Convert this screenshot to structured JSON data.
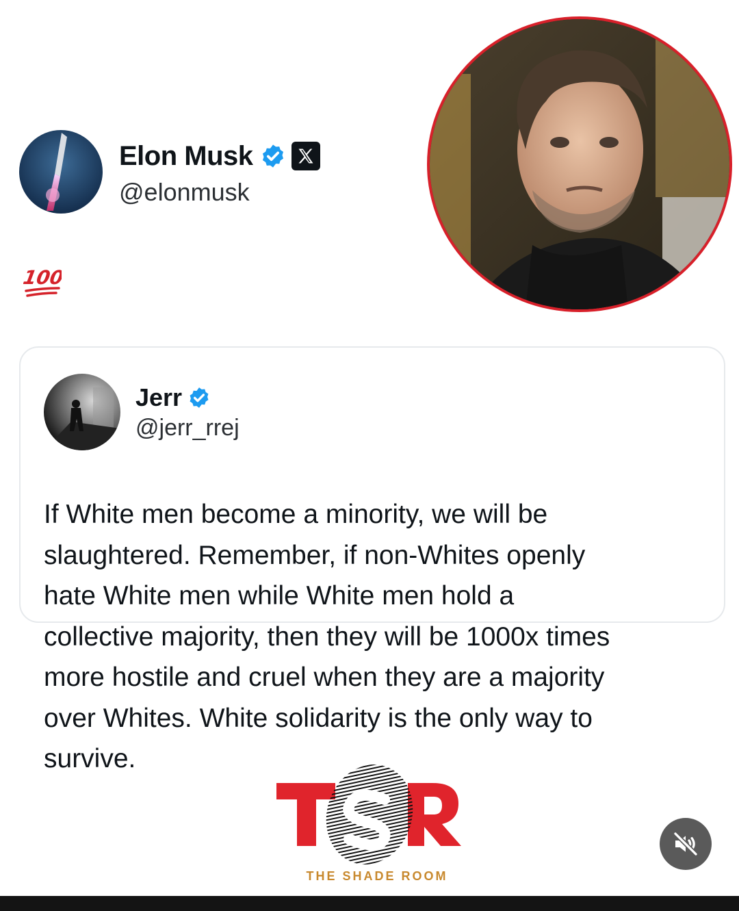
{
  "author": {
    "name": "Elon Musk",
    "handle": "@elonmusk",
    "verified": true,
    "platform_icon": "x-logo-icon"
  },
  "tweet": {
    "emoji": "100",
    "emoji_icon": "hundred-points-icon"
  },
  "quoted": {
    "name": "Jerr",
    "handle": "@jerr_rrej",
    "verified": true,
    "lines": [
      "If White men become a minority, we will be",
      "slaughtered. Remember, if non-Whites openly",
      "hate White men while White men hold a",
      "collective majority, then they will be 1000x times",
      "more hostile and cruel when they are a majority",
      "over Whites. White solidarity is the only way to",
      "survive."
    ]
  },
  "watermark": {
    "logo_text": "TSR",
    "caption": "THE SHADE ROOM"
  },
  "controls": {
    "mute_icon": "muted-speaker-icon"
  },
  "colors": {
    "verified_blue": "#1d9bf0",
    "photo_border": "#d8202a",
    "tsr_red": "#e0242c",
    "caption_gold": "#c8892e"
  }
}
